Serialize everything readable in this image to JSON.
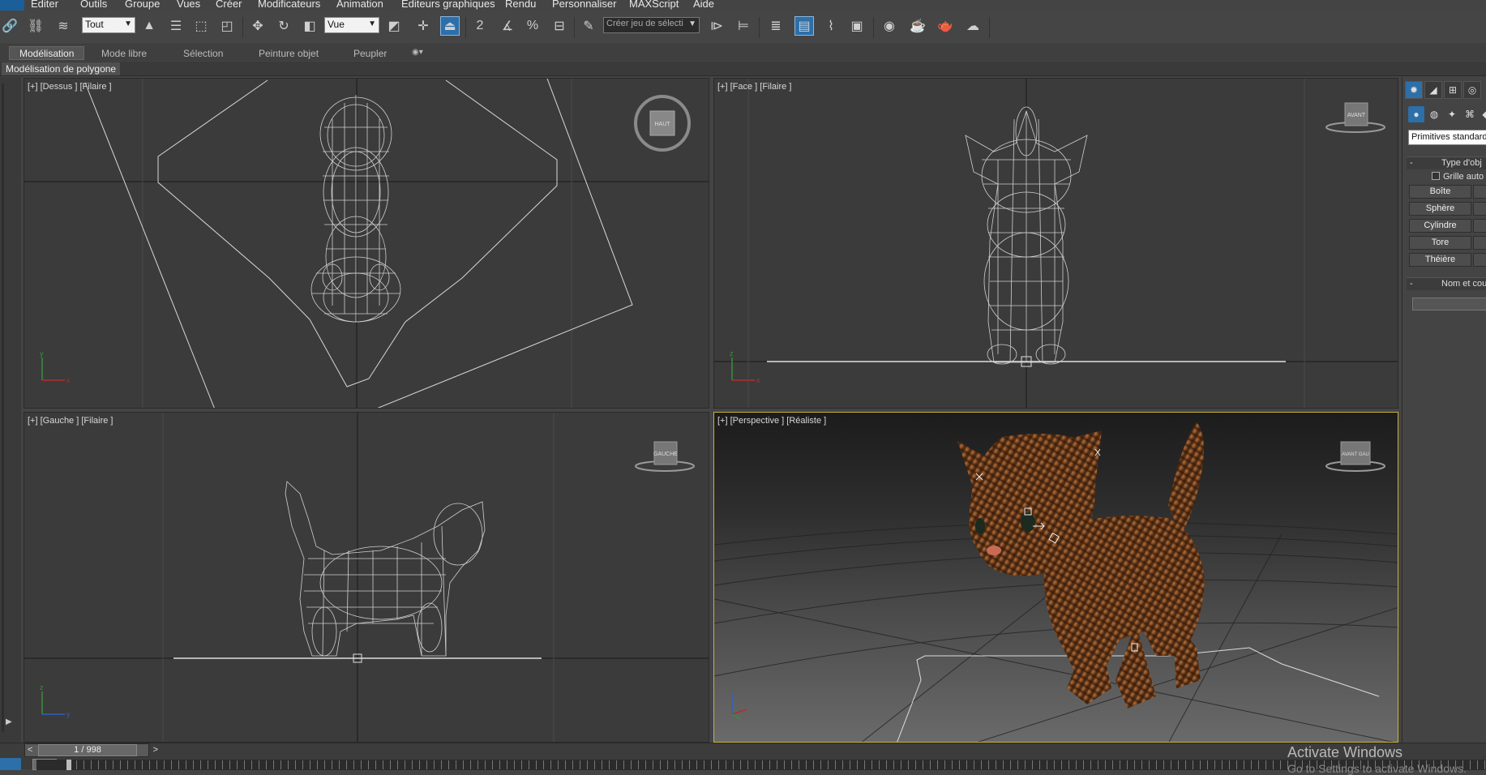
{
  "menu": [
    "Editer",
    "Outils",
    "Groupe",
    "Vues",
    "Créer",
    "Modificateurs",
    "Animation",
    "Editeurs graphiques",
    "Rendu",
    "Personnaliser",
    "MAXScript",
    "Aide"
  ],
  "toolbar": {
    "selection_filter": "Tout",
    "reference_coord": "Vue",
    "named_selection_placeholder": "Créer jeu de sélecti",
    "snap_label": "2",
    "percent_snap_label": "%"
  },
  "ribbon": {
    "tabs": [
      "Modélisation",
      "Mode libre",
      "Sélection",
      "Peinture objet",
      "Peupler"
    ],
    "active_tab": "Modélisation",
    "panel": "Modélisation de polygone"
  },
  "viewports": {
    "top": {
      "label": "[+] [Dessus ] [Filaire ]",
      "cube": "HAUT"
    },
    "front": {
      "label": "[+] [Face ] [Filaire ]",
      "cube": "AVANT"
    },
    "left": {
      "label": "[+] [Gauche ] [Filaire ]",
      "cube": "GAUCHE"
    },
    "perspective": {
      "label": "[+] [Perspective ] [Réaliste ]",
      "cube": "AVANT GAU"
    }
  },
  "command_panel": {
    "category": "Primitives standard",
    "object_type_title": "Type d'obj",
    "autogrid": "Grille auto",
    "buttons": [
      "Boîte",
      "Sphère",
      "Cylindre",
      "Tore",
      "Théière"
    ],
    "name_color_title": "Nom et cou"
  },
  "timeline": {
    "frame": "1 / 998",
    "prev": "<",
    "next": ">"
  },
  "watermark": {
    "line1": "Activate Windows",
    "line2": "Go to Settings to activate Windows."
  }
}
